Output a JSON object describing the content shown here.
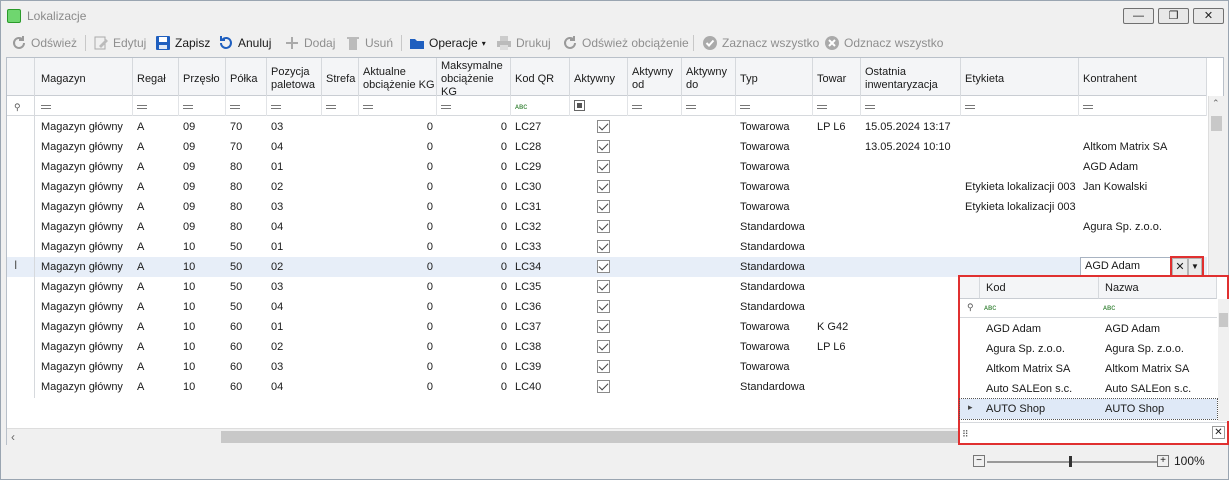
{
  "window": {
    "title": "Lokalizacje",
    "minimize": "—",
    "restore": "❐",
    "close": "✕"
  },
  "toolbar": {
    "refresh": "Odśwież",
    "edit": "Edytuj",
    "save": "Zapisz",
    "cancel": "Anuluj",
    "add": "Dodaj",
    "delete": "Usuń",
    "operations": "Operacje",
    "print": "Drukuj",
    "refresh_load": "Odśwież obciążenie",
    "select_all": "Zaznacz wszystko",
    "deselect_all": "Odznacz wszystko"
  },
  "columns": [
    "Magazyn",
    "Regał",
    "Przęsło",
    "Półka",
    "Pozycja paletowa",
    "Strefa",
    "Aktualne obciążenie KG",
    "Maksymalne obciążenie KG",
    "Kod QR",
    "Aktywny",
    "Aktywny od",
    "Aktywny do",
    "Typ",
    "Towar",
    "Ostatnia inwentaryzacja",
    "Etykieta",
    "Kontrahent"
  ],
  "rows": [
    {
      "magazyn": "Magazyn główny",
      "regal": "A",
      "przeslo": "09",
      "polka": "70",
      "poz": "03",
      "strefa": "",
      "akt": "0",
      "maks": "0",
      "kod": "LC27",
      "aktywny": true,
      "od": "",
      "do": "",
      "typ": "Towarowa",
      "towar": "LP L6",
      "inw": "15.05.2024 13:17",
      "etykieta": "",
      "kontrahent": ""
    },
    {
      "magazyn": "Magazyn główny",
      "regal": "A",
      "przeslo": "09",
      "polka": "70",
      "poz": "04",
      "strefa": "",
      "akt": "0",
      "maks": "0",
      "kod": "LC28",
      "aktywny": true,
      "od": "",
      "do": "",
      "typ": "Towarowa",
      "towar": "",
      "inw": "13.05.2024 10:10",
      "etykieta": "",
      "kontrahent": "Altkom Matrix SA"
    },
    {
      "magazyn": "Magazyn główny",
      "regal": "A",
      "przeslo": "09",
      "polka": "80",
      "poz": "01",
      "strefa": "",
      "akt": "0",
      "maks": "0",
      "kod": "LC29",
      "aktywny": true,
      "od": "",
      "do": "",
      "typ": "Towarowa",
      "towar": "",
      "inw": "",
      "etykieta": "",
      "kontrahent": "AGD Adam"
    },
    {
      "magazyn": "Magazyn główny",
      "regal": "A",
      "przeslo": "09",
      "polka": "80",
      "poz": "02",
      "strefa": "",
      "akt": "0",
      "maks": "0",
      "kod": "LC30",
      "aktywny": true,
      "od": "",
      "do": "",
      "typ": "Towarowa",
      "towar": "",
      "inw": "",
      "etykieta": "Etykieta lokalizacji 003",
      "kontrahent": "Jan Kowalski"
    },
    {
      "magazyn": "Magazyn główny",
      "regal": "A",
      "przeslo": "09",
      "polka": "80",
      "poz": "03",
      "strefa": "",
      "akt": "0",
      "maks": "0",
      "kod": "LC31",
      "aktywny": true,
      "od": "",
      "do": "",
      "typ": "Towarowa",
      "towar": "",
      "inw": "",
      "etykieta": "Etykieta lokalizacji 003",
      "kontrahent": ""
    },
    {
      "magazyn": "Magazyn główny",
      "regal": "A",
      "przeslo": "09",
      "polka": "80",
      "poz": "04",
      "strefa": "",
      "akt": "0",
      "maks": "0",
      "kod": "LC32",
      "aktywny": true,
      "od": "",
      "do": "",
      "typ": "Standardowa",
      "towar": "",
      "inw": "",
      "etykieta": "",
      "kontrahent": "Agura Sp. z.o.o."
    },
    {
      "magazyn": "Magazyn główny",
      "regal": "A",
      "przeslo": "10",
      "polka": "50",
      "poz": "01",
      "strefa": "",
      "akt": "0",
      "maks": "0",
      "kod": "LC33",
      "aktywny": true,
      "od": "",
      "do": "",
      "typ": "Standardowa",
      "towar": "",
      "inw": "",
      "etykieta": "",
      "kontrahent": ""
    },
    {
      "magazyn": "Magazyn główny",
      "regal": "A",
      "przeslo": "10",
      "polka": "50",
      "poz": "02",
      "strefa": "",
      "akt": "0",
      "maks": "0",
      "kod": "LC34",
      "aktywny": true,
      "od": "",
      "do": "",
      "typ": "Standardowa",
      "towar": "",
      "inw": "",
      "etykieta": "",
      "kontrahent": "AGD Adam",
      "selected": true
    },
    {
      "magazyn": "Magazyn główny",
      "regal": "A",
      "przeslo": "10",
      "polka": "50",
      "poz": "03",
      "strefa": "",
      "akt": "0",
      "maks": "0",
      "kod": "LC35",
      "aktywny": true,
      "od": "",
      "do": "",
      "typ": "Standardowa",
      "towar": "",
      "inw": "",
      "etykieta": "",
      "kontrahent": ""
    },
    {
      "magazyn": "Magazyn główny",
      "regal": "A",
      "przeslo": "10",
      "polka": "50",
      "poz": "04",
      "strefa": "",
      "akt": "0",
      "maks": "0",
      "kod": "LC36",
      "aktywny": true,
      "od": "",
      "do": "",
      "typ": "Standardowa",
      "towar": "",
      "inw": "",
      "etykieta": "",
      "kontrahent": ""
    },
    {
      "magazyn": "Magazyn główny",
      "regal": "A",
      "przeslo": "10",
      "polka": "60",
      "poz": "01",
      "strefa": "",
      "akt": "0",
      "maks": "0",
      "kod": "LC37",
      "aktywny": true,
      "od": "",
      "do": "",
      "typ": "Towarowa",
      "towar": "K G42",
      "inw": "",
      "etykieta": "",
      "kontrahent": ""
    },
    {
      "magazyn": "Magazyn główny",
      "regal": "A",
      "przeslo": "10",
      "polka": "60",
      "poz": "02",
      "strefa": "",
      "akt": "0",
      "maks": "0",
      "kod": "LC38",
      "aktywny": true,
      "od": "",
      "do": "",
      "typ": "Towarowa",
      "towar": "LP L6",
      "inw": "",
      "etykieta": "",
      "kontrahent": ""
    },
    {
      "magazyn": "Magazyn główny",
      "regal": "A",
      "przeslo": "10",
      "polka": "60",
      "poz": "03",
      "strefa": "",
      "akt": "0",
      "maks": "0",
      "kod": "LC39",
      "aktywny": true,
      "od": "",
      "do": "",
      "typ": "Towarowa",
      "towar": "",
      "inw": "",
      "etykieta": "",
      "kontrahent": ""
    },
    {
      "magazyn": "Magazyn główny",
      "regal": "A",
      "przeslo": "10",
      "polka": "60",
      "poz": "04",
      "strefa": "",
      "akt": "0",
      "maks": "0",
      "kod": "LC40",
      "aktywny": true,
      "od": "",
      "do": "",
      "typ": "Standardowa",
      "towar": "",
      "inw": "",
      "etykieta": "",
      "kontrahent": ""
    }
  ],
  "popup": {
    "columns": [
      "Kod",
      "Nazwa"
    ],
    "rows": [
      {
        "kod": "AGD Adam",
        "nazwa": "AGD Adam"
      },
      {
        "kod": "Agura Sp. z.o.o.",
        "nazwa": "Agura Sp. z.o.o."
      },
      {
        "kod": "Altkom Matrix SA",
        "nazwa": "Altkom Matrix SA"
      },
      {
        "kod": "Auto SALEon s.c.",
        "nazwa": "Auto SALEon s.c."
      },
      {
        "kod": "AUTO Shop",
        "nazwa": "AUTO Shop",
        "current": true
      }
    ]
  },
  "zoom": {
    "minus": "−",
    "plus": "+",
    "value": "100%",
    "level": 1.0
  },
  "colors": {
    "accent": "#1f5fbf",
    "popup_border": "#e03030",
    "selected_row": "#e7eef8"
  }
}
